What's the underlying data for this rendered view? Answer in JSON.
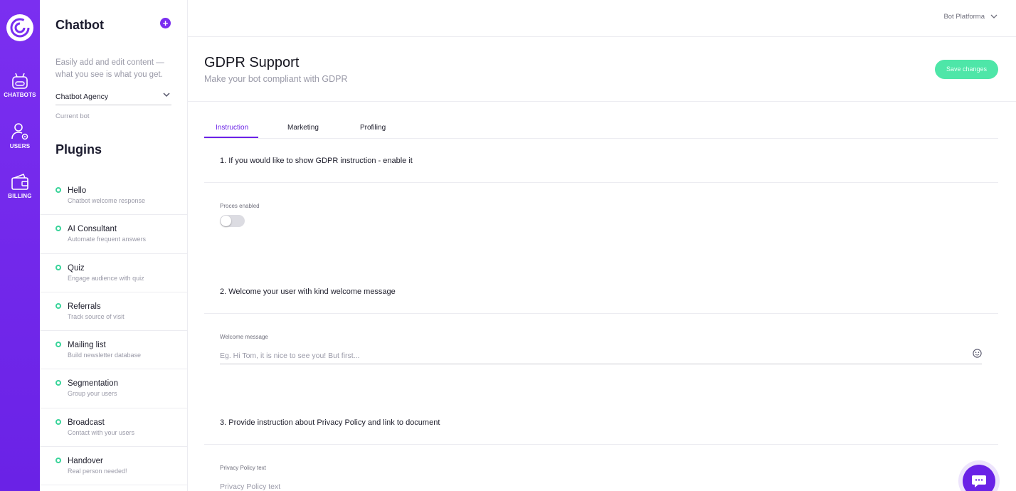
{
  "rail": {
    "items": [
      {
        "label": "CHATBOTS",
        "icon": "bot-icon"
      },
      {
        "label": "USERS",
        "icon": "user-settings-icon"
      },
      {
        "label": "BILLING",
        "icon": "wallet-icon"
      }
    ]
  },
  "sidebar": {
    "title": "Chatbot",
    "description": "Easily add and edit content — what you see is what you get.",
    "bot_select": {
      "value": "Chatbot Agency",
      "hint": "Current bot"
    },
    "plugins_title": "Plugins",
    "plugins": [
      {
        "name": "Hello",
        "sub": "Chatbot welcome response"
      },
      {
        "name": "AI Consultant",
        "sub": "Automate frequent answers"
      },
      {
        "name": "Quiz",
        "sub": "Engage audience with quiz"
      },
      {
        "name": "Referrals",
        "sub": "Track source of visit"
      },
      {
        "name": "Mailing list",
        "sub": "Build newsletter database"
      },
      {
        "name": "Segmentation",
        "sub": "Group your users"
      },
      {
        "name": "Broadcast",
        "sub": "Contact with your users"
      },
      {
        "name": "Handover",
        "sub": "Real person needed!"
      }
    ]
  },
  "topbar": {
    "workspace": "Bot Platforma"
  },
  "page": {
    "title": "GDPR Support",
    "subtitle": "Make your bot compliant with GDPR",
    "save_label": "Save changes"
  },
  "tabs": [
    {
      "label": "Instruction",
      "active": true
    },
    {
      "label": "Marketing",
      "active": false
    },
    {
      "label": "Profiling",
      "active": false
    }
  ],
  "sections": {
    "s1_title": "1. If you would like to show GDPR instruction - enable it",
    "toggle_label": "Proces enabled",
    "toggle_on": false,
    "s2_title": "2. Welcome your user with kind welcome message",
    "welcome_label": "Welcome message",
    "welcome_placeholder": "Eg. Hi Tom, it is nice to see you! But first...",
    "welcome_value": "",
    "s3_title": "3. Provide instruction about Privacy Policy and link to document",
    "privacy_label": "Privacy Policy text",
    "privacy_placeholder": "Privacy Policy text",
    "privacy_value": ""
  },
  "colors": {
    "brand": "#6a22e6",
    "accent_green": "#4ee6a8",
    "plugin_dot": "#3ad49a"
  }
}
